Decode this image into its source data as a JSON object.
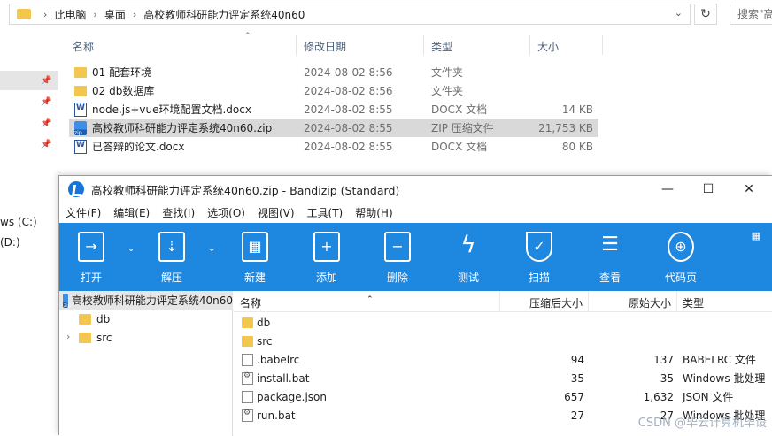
{
  "explorer": {
    "breadcrumb": [
      "此电脑",
      "桌面",
      "高校教师科研能力评定系统40n60"
    ],
    "search_placeholder": "搜索\"高",
    "columns": {
      "name": "名称",
      "date": "修改日期",
      "type": "类型",
      "size": "大小"
    },
    "files": [
      {
        "name": "01  配套环境",
        "date": "2024-08-02 8:56",
        "type": "文件夹",
        "size": "",
        "kind": "folder"
      },
      {
        "name": "02 db数据库",
        "date": "2024-08-02 8:56",
        "type": "文件夹",
        "size": "",
        "kind": "folder"
      },
      {
        "name": "node.js+vue环境配置文档.docx",
        "date": "2024-08-02 8:55",
        "type": "DOCX 文档",
        "size": "14 KB",
        "kind": "docx"
      },
      {
        "name": "高校教师科研能力评定系统40n60.zip",
        "date": "2024-08-02 8:55",
        "type": "ZIP 压缩文件",
        "size": "21,753 KB",
        "kind": "zip"
      },
      {
        "name": "已答辩的论文.docx",
        "date": "2024-08-02 8:55",
        "type": "DOCX 文档",
        "size": "80 KB",
        "kind": "docx"
      }
    ],
    "nav_drives": [
      "ws (C:)",
      "(D:)"
    ]
  },
  "bandizip": {
    "title": "高校教师科研能力评定系统40n60.zip - Bandizip (Standard)",
    "menu": [
      "文件(F)",
      "编辑(E)",
      "查找(I)",
      "选项(O)",
      "视图(V)",
      "工具(T)",
      "帮助(H)"
    ],
    "toolbar": [
      "打开",
      "解压",
      "新建",
      "添加",
      "删除",
      "测试",
      "扫描",
      "查看",
      "代码页"
    ],
    "tree_root": "高校教师科研能力评定系统40n60",
    "tree_nodes": [
      "db",
      "src"
    ],
    "columns": {
      "name": "名称",
      "compressed": "压缩后大小",
      "original": "原始大小",
      "type": "类型"
    },
    "entries": [
      {
        "name": "db",
        "compressed": "",
        "original": "",
        "type": "",
        "kind": "folder"
      },
      {
        "name": "src",
        "compressed": "",
        "original": "",
        "type": "",
        "kind": "folder"
      },
      {
        "name": ".babelrc",
        "compressed": "94",
        "original": "137",
        "type": "BABELRC 文件",
        "kind": "file"
      },
      {
        "name": "install.bat",
        "compressed": "35",
        "original": "35",
        "type": "Windows 批处理",
        "kind": "gear"
      },
      {
        "name": "package.json",
        "compressed": "657",
        "original": "1,632",
        "type": "JSON 文件",
        "kind": "file"
      },
      {
        "name": "run.bat",
        "compressed": "27",
        "original": "27",
        "type": "Windows 批处理",
        "kind": "gear"
      }
    ]
  },
  "watermark": "CSDN @毕云计算机毕设",
  "colors": {
    "toolbar": "#1e87e0",
    "folder": "#f3c64f",
    "selection": "#d9d9d9"
  }
}
